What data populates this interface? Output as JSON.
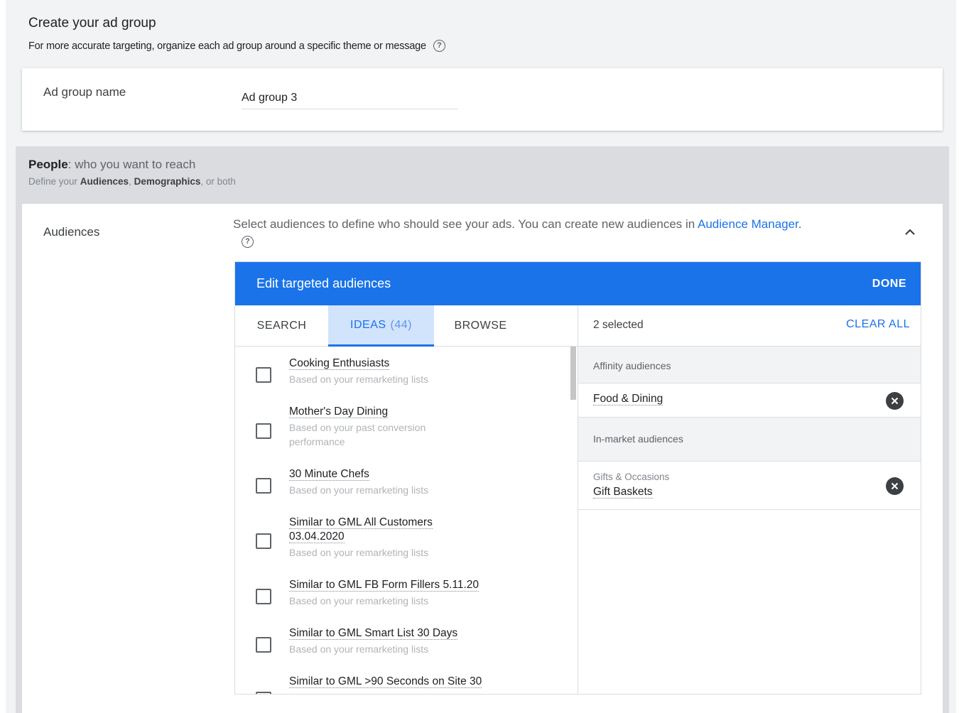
{
  "header": {
    "title": "Create your ad group",
    "subtitle": "For more accurate targeting, organize each ad group around a specific theme or message"
  },
  "ad_group": {
    "label": "Ad group name",
    "value": "Ad group 3"
  },
  "people": {
    "title_bold": "People",
    "title_rest": ": who you want to reach",
    "sub_prefix": "Define your ",
    "sub_audiences": "Audiences",
    "sub_comma": ", ",
    "sub_demographics": "Demographics",
    "sub_suffix": ", or both"
  },
  "audiences": {
    "label": "Audiences",
    "description": "Select audiences to define who should see your ads.  You can create new audiences in ",
    "link": "Audience Manager",
    "description_end": "."
  },
  "editor": {
    "title": "Edit targeted audiences",
    "done": "DONE",
    "tabs": {
      "search": "SEARCH",
      "ideas": "IDEAS",
      "ideas_count": "(44)",
      "browse": "BROWSE"
    },
    "items": [
      {
        "title": "Cooking Enthusiasts",
        "sub": "Based on your remarketing lists"
      },
      {
        "title": "Mother's Day Dining",
        "sub": "Based on your past conversion performance"
      },
      {
        "title": "30 Minute Chefs",
        "sub": "Based on your remarketing lists"
      },
      {
        "title": "Similar to GML All Customers 03.04.2020",
        "sub": "Based on your remarketing lists"
      },
      {
        "title": "Similar to GML FB Form Fillers 5.11.20",
        "sub": "Based on your remarketing lists"
      },
      {
        "title": "Similar to GML Smart List 30 Days",
        "sub": "Based on your remarketing lists"
      },
      {
        "title": "Similar to GML >90 Seconds on Site 30",
        "sub": ""
      }
    ],
    "selected": {
      "count": "2 selected",
      "clear_all": "CLEAR ALL",
      "groups": [
        {
          "name": "Affinity audiences",
          "items": [
            {
              "category": "",
              "name": "Food & Dining"
            }
          ]
        },
        {
          "name": "In-market audiences",
          "items": [
            {
              "category": "Gifts & Occasions",
              "name": "Gift Baskets"
            }
          ]
        }
      ]
    }
  },
  "icons": {
    "help": "help-circle-icon",
    "collapse": "chevron-up-icon",
    "remove": "close-circle-icon"
  },
  "colors": {
    "accent": "#1a73e8",
    "ideas_tab_bg": "#d2e3fc",
    "band": "#dadce0"
  }
}
